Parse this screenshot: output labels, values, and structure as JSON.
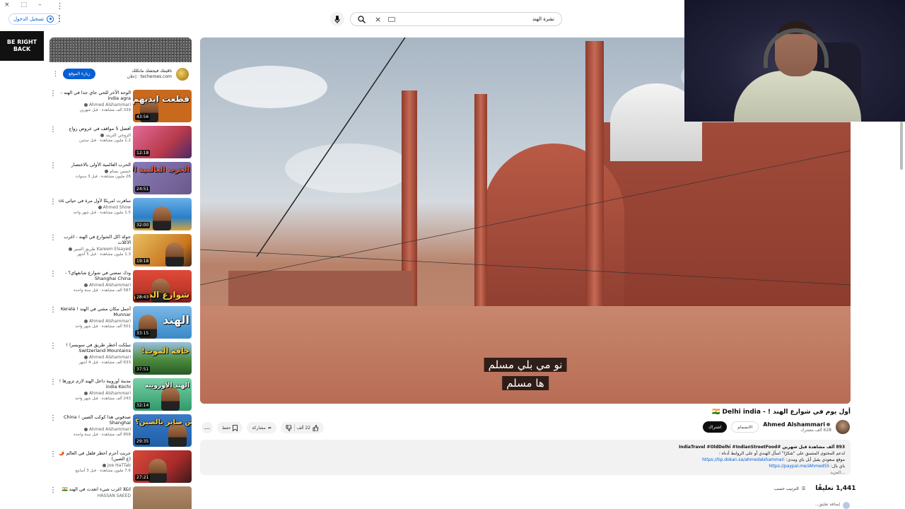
{
  "window": {
    "controls": [
      "×",
      "⬚",
      "–"
    ],
    "more": "⋮"
  },
  "header": {
    "signin_label": "تسجيل الدخول",
    "search_value": "نشرة الهند",
    "clear_icon": "×"
  },
  "brb": {
    "text": "BE RIGHT BACK"
  },
  "ad": {
    "title": "تاڤينثك فيجشك ماتكلك",
    "site": "techeroes.com · إعلان",
    "button": "زيارة الموقع",
    "more": "⋮"
  },
  "recommendations": [
    {
      "title": "الوجه الآخر للحي جاي جدا في الهند - india agra",
      "channel": "Ahmed Alshammari",
      "stats": "339 ألف مشاهدة · قبل شهرين",
      "duration": "43:56",
      "thumb_text": "قطعت ايديهم",
      "thumb_bg": "#c8691e"
    },
    {
      "title": "أفضل 5 مواقف في عروض زواج",
      "channel": "الزوجي التريند",
      "stats": "1.2 مليون مشاهدة · قبل سنتين",
      "duration": "12:18",
      "thumb_text": "",
      "thumb_bg": "#b73a4a"
    },
    {
      "title": "الحرب العالمية الأولى بالاختصار",
      "channel": "حسين بسام",
      "stats": "26 مليون مشاهدة · قبل 3 سنوات",
      "duration": "24:51",
      "thumb_text": "الحرب العالمية الأولى",
      "thumb_bg": "#6a5a8a"
    },
    {
      "title": "سافرت امريكا لأول مرة في حياتي us",
      "channel": "Ahmed Show",
      "stats": "1.5 مليون مشاهدة · قبل شهر واحد",
      "duration": "32:00",
      "thumb_text": "",
      "thumb_bg": "#2a7fc8"
    },
    {
      "title": "جولة اكل الشوارع في الهند - اغرب الاكلات",
      "channel": "Kareem Elsayed طريق السير",
      "stats": "1.3 مليون مشاهدة · قبل 5 أشهر",
      "duration": "19:18",
      "thumb_text": "",
      "thumb_bg": "#d8a43a"
    },
    {
      "title": "ودك تمشي في شوارع شانغهاي؟ - Shanghai China",
      "channel": "Ahmed Alshammari",
      "stats": "587 ألف مشاهدة · قبل سنة واحدة",
      "duration": "28:43",
      "thumb_text": "شوارع الصين",
      "thumb_bg": "#c0392b"
    },
    {
      "title": "أجمل مكان مشي في الهند ! Kerala Munnar",
      "channel": "Ahmed Alshammari",
      "stats": "501 ألف مشاهدة · قبل شهر واحد",
      "duration": "33:15",
      "thumb_text": "الهند",
      "thumb_bg": "#3a8ac8"
    },
    {
      "title": "سلكت أخطر طريق في سويسرا ! Switzerland Mountains",
      "channel": "Ahmed Alshammari",
      "stats": "633 ألف مشاهدة · قبل 4 أشهر",
      "duration": "37:51",
      "thumb_text": "حافة الموت!",
      "thumb_bg": "#4a8a3a"
    },
    {
      "title": "مدينة أوروبية داخل الهند لازم تزورها ! india Kochi",
      "channel": "Ahmed Alshammari",
      "stats": "243 ألف مشاهدة · قبل شهر واحد",
      "duration": "32:14",
      "thumb_text": "الهند الأوروبية",
      "thumb_bg": "#2f9a6a"
    },
    {
      "title": "صدقوني هذا كوكب الصين ! China Shanghai",
      "channel": "Ahmed Alshammari",
      "stats": "858 ألف مشاهدة · قبل سنة واحدة",
      "duration": "29:35",
      "thumb_text": "وش صاير بالصين؟",
      "thumb_bg": "#1f5fa8"
    },
    {
      "title": "جربت أجرم أخطر فلفل في العالم 🌶️ (ع الصين)",
      "channel": "Joe HaTTab",
      "stats": "7.6 مليون مشاهدة · قبل 3 أسابيع",
      "duration": "27:21",
      "thumb_text": "",
      "thumb_bg": "#a82a2a"
    },
    {
      "title": "ائكلا اغرب شيء اتغدت في الهند 🇮🇳",
      "channel": "HASSAN SAEED",
      "stats": "",
      "duration": "",
      "thumb_text": "",
      "thumb_bg": "#8a6a4a"
    }
  ],
  "player": {
    "subtitle_line1": "نو مي بلي مسلم",
    "subtitle_line2": "ها مسلم"
  },
  "video": {
    "title": "أول يوم في شوارع الهند ! - 🇮🇳 Delhi india",
    "channel": "Ahmed Alshammari",
    "subscribers": "628 ألف مشترك",
    "join": "الانضمام",
    "subscribe": "اشتراك",
    "likes": "22 ألف",
    "share": "مشاركة",
    "save": "حفظ",
    "more": "..."
  },
  "description": {
    "stats": "893 ألف مشاهدة  قبل شهرين  #IndiaTravel #OldDelhi #IndianStreetFood",
    "line1": "لدعم المحتوى المتسق على \"شكرًا\" اسأل الهندي أو على الروابط أدناه :",
    "line2": "موقع سعودي يقبل أبل باي ومدى:",
    "link1": "https://tip.dokan.sa/ahmedalshammari",
    "line3": "باي بال:",
    "link2": "https://paypal.me/iAhmed55",
    "more": "...المزيد"
  },
  "comments": {
    "count": "1,441 تعليقًا",
    "sort": "الترتيب حسب",
    "add": "إضافة تعليق..."
  },
  "colors": {
    "link": "#065fd4",
    "subscribe_bg": "#0f0f0f"
  }
}
